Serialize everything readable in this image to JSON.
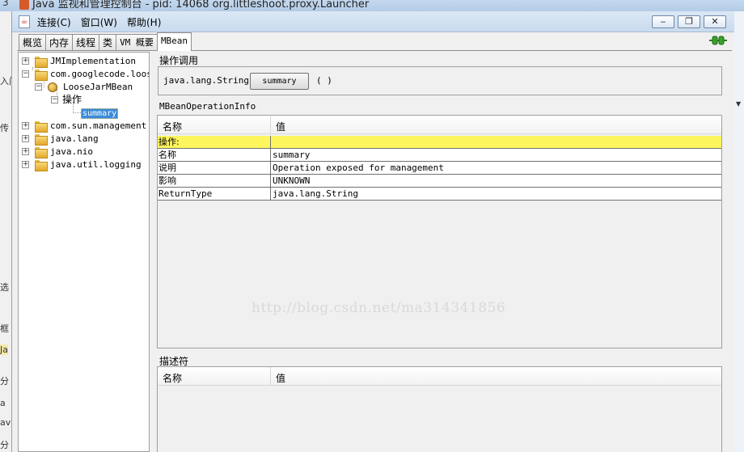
{
  "background": {
    "title": "Java 监视和管理控制台 - pid: 14068 org.littleshoot.proxy.Launcher",
    "corner_digit": "3",
    "left_fragments": [
      "入门",
      "传",
      "选",
      "框",
      "Ja",
      "分",
      "a",
      "av",
      "分"
    ]
  },
  "window": {
    "menu": [
      "连接(C)",
      "窗口(W)",
      "帮助(H)"
    ],
    "controls": {
      "minimize": "‒",
      "restore": "❐",
      "close": "✕"
    }
  },
  "tabs": [
    "概览",
    "内存",
    "线程",
    "类",
    "VM 概要",
    "MBean"
  ],
  "active_tab": "MBean",
  "tree": {
    "nodes": [
      {
        "label": "JMImplementation",
        "expander": "+"
      },
      {
        "label": "com.googlecode.loose",
        "expander": "−"
      },
      {
        "label": "LooseJarMBean",
        "expander": "−"
      },
      {
        "label": "操作",
        "expander": "−"
      },
      {
        "label": "summary"
      },
      {
        "label": "com.sun.management",
        "expander": "+"
      },
      {
        "label": "java.lang",
        "expander": "+"
      },
      {
        "label": "java.nio",
        "expander": "+"
      },
      {
        "label": "java.util.logging",
        "expander": "+"
      }
    ]
  },
  "operation": {
    "section_title": "操作调用",
    "return_type": "java.lang.String",
    "button_label": "summary",
    "params": "( )"
  },
  "info": {
    "section_title": "MBeanOperationInfo",
    "col_name": "名称",
    "col_value": "值",
    "rows": [
      {
        "key": "操作:",
        "value": ""
      },
      {
        "key": "名称",
        "value": "summary"
      },
      {
        "key": "说明",
        "value": "Operation exposed for management"
      },
      {
        "key": "影响",
        "value": "UNKNOWN"
      },
      {
        "key": "ReturnType",
        "value": "java.lang.String"
      }
    ]
  },
  "watermark": "http://blog.csdn.net/ma314341856",
  "descriptor": {
    "section_title": "描述符",
    "col_name": "名称",
    "col_value": "值"
  },
  "colors": {
    "highlight_row": "#fdf65e",
    "selection": "#3a8bd9",
    "plug_icon": "#3aa12b"
  }
}
